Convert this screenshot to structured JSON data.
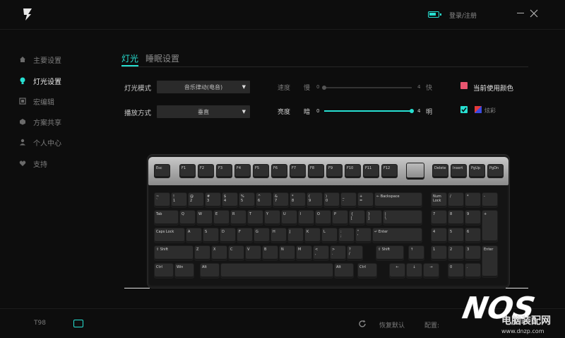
{
  "window": {
    "login_label": "登录/注册",
    "accent": "#27e0d2"
  },
  "sidebar": {
    "items": [
      {
        "label": "主要设置",
        "icon": "home-icon",
        "active": false
      },
      {
        "label": "灯光设置",
        "icon": "bulb-icon",
        "active": true
      },
      {
        "label": "宏编辑",
        "icon": "macro-icon",
        "active": false
      },
      {
        "label": "方案共享",
        "icon": "share-icon",
        "active": false
      },
      {
        "label": "个人中心",
        "icon": "user-icon",
        "active": false
      },
      {
        "label": "支持",
        "icon": "heart-icon",
        "active": false
      }
    ]
  },
  "tabs": [
    {
      "label": "灯光",
      "active": true
    },
    {
      "label": "睡眠设置",
      "active": false
    }
  ],
  "lighting": {
    "mode_label": "灯光模式",
    "mode_value": "音乐律动(电音)",
    "play_label": "播放方式",
    "play_value": "垂直",
    "speed": {
      "label": "速度",
      "min_label": "慢",
      "max_label": "快",
      "min": "0",
      "max": "4",
      "value": 0
    },
    "brightness": {
      "label": "亮度",
      "min_label": "暗",
      "max_label": "明",
      "min": "0",
      "max": "4",
      "value": 4
    },
    "current_color_label": "当前使用颜色",
    "current_color": "#e85570",
    "rainbow_label": "炫彩",
    "rainbow_checked": true
  },
  "keyboard": {
    "model": "T98",
    "top_row": [
      "Esc",
      "F1",
      "F2",
      "F3",
      "F4",
      "F5",
      "F6",
      "F7",
      "F8",
      "F9",
      "F10",
      "F11",
      "F12",
      "Delete",
      "Insert",
      "PgUp",
      "PgDn"
    ],
    "row1": [
      "~\n`",
      "!\n1",
      "@\n2",
      "#\n3",
      "$\n4",
      "%\n5",
      "^\n6",
      "&\n7",
      "*\n8",
      "(\n9",
      ")\n0",
      "_\n-",
      "+\n=",
      "← Backspace",
      "Num\nLock",
      "/",
      "*",
      "-"
    ],
    "row2": [
      "Tab",
      "Q",
      "W",
      "E",
      "R",
      "T",
      "Y",
      "U",
      "I",
      "O",
      "P",
      "{\n[",
      "}\n]",
      "|\n\\",
      "7",
      "8",
      "9",
      "+"
    ],
    "row3": [
      "Caps Lock",
      "A",
      "S",
      "D",
      "F",
      "G",
      "H",
      "J",
      "K",
      "L",
      ":\n;",
      "\"\n'",
      "↵ Enter",
      "4",
      "5",
      "6"
    ],
    "row4": [
      "⇧ Shift",
      "Z",
      "X",
      "C",
      "V",
      "B",
      "N",
      "M",
      "<\n,",
      ">\n.",
      "?\n/",
      "⇧ Shift",
      "↑",
      "1",
      "2",
      "3",
      "Enter"
    ],
    "row5": [
      "Ctrl",
      "Win",
      "Alt",
      "",
      "Alt",
      "Ctrl",
      "←",
      "↓",
      "→",
      "0",
      "."
    ]
  },
  "bottom": {
    "reset_label": "恢复默认",
    "config_label": "配置:",
    "watermark": "电脑装配网",
    "watermark_url": "www.dnzp.com"
  }
}
